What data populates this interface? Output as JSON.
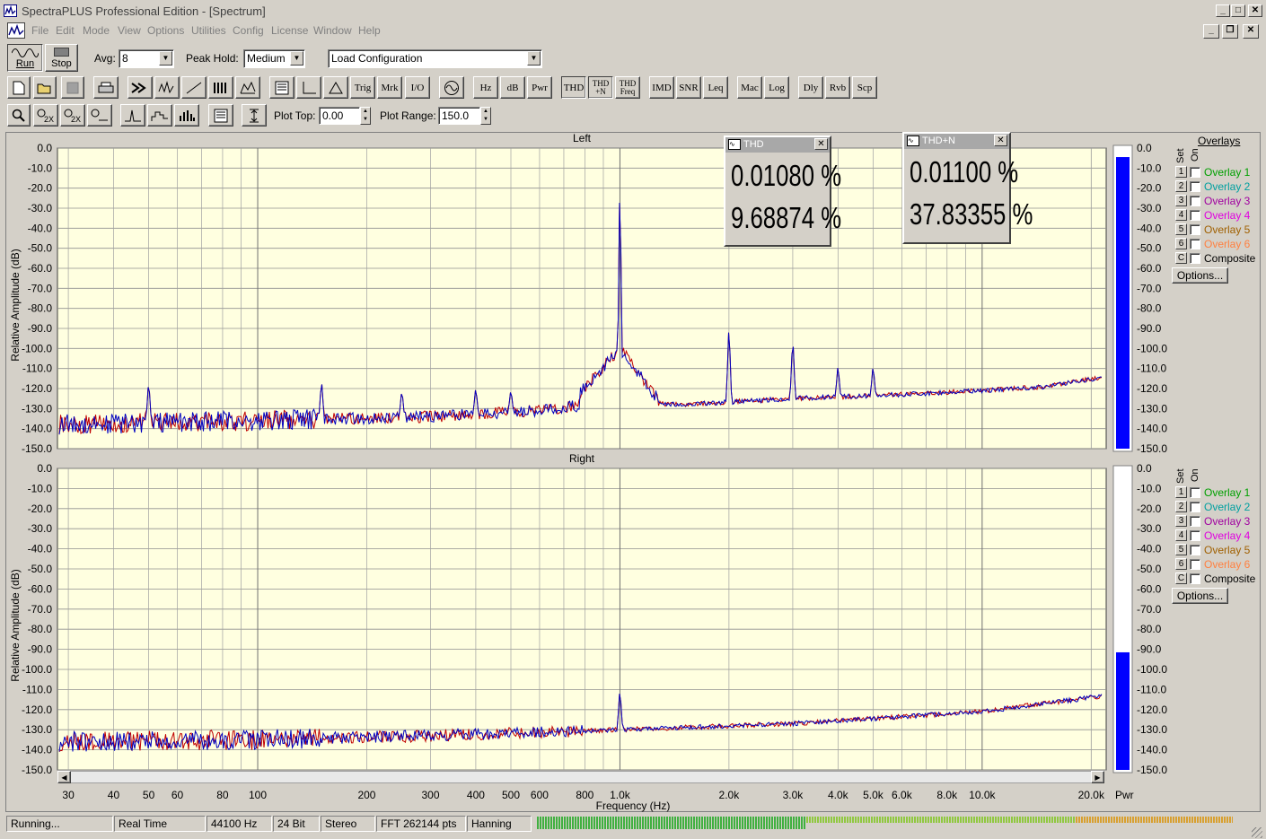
{
  "window": {
    "title": "SpectraPLUS Professional Edition - [Spectrum]"
  },
  "menu": [
    "File",
    "Edit",
    "Mode",
    "View",
    "Options",
    "Utilities",
    "Config",
    "License",
    "Window",
    "Help"
  ],
  "toolbar1": {
    "run": "Run",
    "stop": "Stop",
    "avg_label": "Avg:",
    "avg_value": "8",
    "peak_label": "Peak Hold:",
    "peak_value": "Medium",
    "config_value": "Load Configuration"
  },
  "toolbar2": [
    "Trig",
    "Mrk",
    "I/O",
    "Hz",
    "dB",
    "Pwr",
    "THD",
    "THD +N",
    "THD Freq",
    "IMD",
    "SNR",
    "Leq",
    "Mac",
    "Log",
    "Dly",
    "Rvb",
    "Scp"
  ],
  "toolbar3": {
    "plot_top_label": "Plot Top:",
    "plot_top_value": "0.00",
    "plot_range_label": "Plot Range:",
    "plot_range_value": "150.0"
  },
  "meters": {
    "thd": {
      "title": "THD",
      "v1": "0.01080 %",
      "v2": "9.68874 %"
    },
    "thdn": {
      "title": "THD+N",
      "v1": "0.01100 %",
      "v2": "37.83355 %"
    }
  },
  "overlays": {
    "header": "Overlays",
    "set": "Set",
    "on": "On",
    "items": [
      {
        "n": "1",
        "label": "Overlay 1",
        "color": "#00a000"
      },
      {
        "n": "2",
        "label": "Overlay 2",
        "color": "#00a0a0"
      },
      {
        "n": "3",
        "label": "Overlay 3",
        "color": "#a000a0"
      },
      {
        "n": "4",
        "label": "Overlay 4",
        "color": "#e000e0"
      },
      {
        "n": "5",
        "label": "Overlay 5",
        "color": "#a06000"
      },
      {
        "n": "6",
        "label": "Overlay 6",
        "color": "#ff8040"
      },
      {
        "n": "C",
        "label": "Composite",
        "color": "#000000"
      }
    ],
    "options": "Options..."
  },
  "chart_data": [
    {
      "type": "line",
      "title": "Left",
      "xlabel": "Frequency (Hz)",
      "ylabel": "Relative Amplitude (dB)",
      "xscale": "log",
      "xlim": [
        28,
        22000
      ],
      "ylim": [
        -150,
        0
      ],
      "yticks": [
        "0.0",
        "-10.0",
        "-20.0",
        "-30.0",
        "-40.0",
        "-50.0",
        "-60.0",
        "-70.0",
        "-80.0",
        "-90.0",
        "-100.0",
        "-110.0",
        "-120.0",
        "-130.0",
        "-140.0",
        "-150.0"
      ],
      "peaks": [
        {
          "x": 50,
          "y": -115
        },
        {
          "x": 150,
          "y": -115
        },
        {
          "x": 1000,
          "y": -10
        },
        {
          "x": 2000,
          "y": -87
        },
        {
          "x": 3000,
          "y": -93
        },
        {
          "x": 4000,
          "y": -108
        },
        {
          "x": 5000,
          "y": -108
        },
        {
          "x": 250,
          "y": -120
        },
        {
          "x": 400,
          "y": -119
        },
        {
          "x": 500,
          "y": -120
        },
        {
          "x": 850,
          "y": -110
        },
        {
          "x": 900,
          "y": -108
        }
      ],
      "floor": [
        {
          "x": 28,
          "y": -138
        },
        {
          "x": 100,
          "y": -136
        },
        {
          "x": 300,
          "y": -134
        },
        {
          "x": 600,
          "y": -131
        },
        {
          "x": 900,
          "y": -127
        },
        {
          "x": 1500,
          "y": -128
        },
        {
          "x": 3000,
          "y": -125
        },
        {
          "x": 6000,
          "y": -123
        },
        {
          "x": 10000,
          "y": -121
        },
        {
          "x": 15000,
          "y": -119
        },
        {
          "x": 22000,
          "y": -114
        }
      ],
      "series": [
        {
          "name": "",
          "color": "#0000c0"
        },
        {
          "name": "",
          "color": "#c00000"
        }
      ]
    },
    {
      "type": "line",
      "title": "Right",
      "xlabel": "Frequency (Hz)",
      "ylabel": "Relative Amplitude (dB)",
      "xscale": "log",
      "xlim": [
        28,
        22000
      ],
      "ylim": [
        -150,
        0
      ],
      "yticks": [
        "0.0",
        "-10.0",
        "-20.0",
        "-30.0",
        "-40.0",
        "-50.0",
        "-60.0",
        "-70.0",
        "-80.0",
        "-90.0",
        "-100.0",
        "-110.0",
        "-120.0",
        "-130.0",
        "-140.0",
        "-150.0"
      ],
      "peaks": [
        {
          "x": 1000,
          "y": -109
        },
        {
          "x": 20000,
          "y": -113
        }
      ],
      "floor": [
        {
          "x": 28,
          "y": -136
        },
        {
          "x": 100,
          "y": -135
        },
        {
          "x": 300,
          "y": -133
        },
        {
          "x": 1000,
          "y": -130
        },
        {
          "x": 3000,
          "y": -127
        },
        {
          "x": 10000,
          "y": -121
        },
        {
          "x": 22000,
          "y": -113
        }
      ],
      "series": [
        {
          "name": "",
          "color": "#0000c0"
        },
        {
          "name": "",
          "color": "#c00000"
        }
      ]
    }
  ],
  "xticks": [
    {
      "f": 30,
      "l": "30"
    },
    {
      "f": 40,
      "l": "40"
    },
    {
      "f": 50,
      "l": "50"
    },
    {
      "f": 60,
      "l": "60"
    },
    {
      "f": 80,
      "l": "80"
    },
    {
      "f": 100,
      "l": "100"
    },
    {
      "f": 200,
      "l": "200"
    },
    {
      "f": 300,
      "l": "300"
    },
    {
      "f": 400,
      "l": "400"
    },
    {
      "f": 500,
      "l": "500"
    },
    {
      "f": 600,
      "l": "600"
    },
    {
      "f": 800,
      "l": "800"
    },
    {
      "f": 1000,
      "l": "1.0k"
    },
    {
      "f": 2000,
      "l": "2.0k"
    },
    {
      "f": 3000,
      "l": "3.0k"
    },
    {
      "f": 4000,
      "l": "4.0k"
    },
    {
      "f": 5000,
      "l": "5.0k"
    },
    {
      "f": 6000,
      "l": "6.0k"
    },
    {
      "f": 8000,
      "l": "8.0k"
    },
    {
      "f": 10000,
      "l": "10.0k"
    },
    {
      "f": 20000,
      "l": "20.0k"
    }
  ],
  "pwr_label": "Pwr",
  "pwr_levels": {
    "left": 0.97,
    "right": 0.39
  },
  "status": [
    "Running...",
    "Real Time",
    "44100 Hz",
    "24 Bit",
    "Stereo",
    "FFT 262144 pts",
    "Hanning"
  ]
}
